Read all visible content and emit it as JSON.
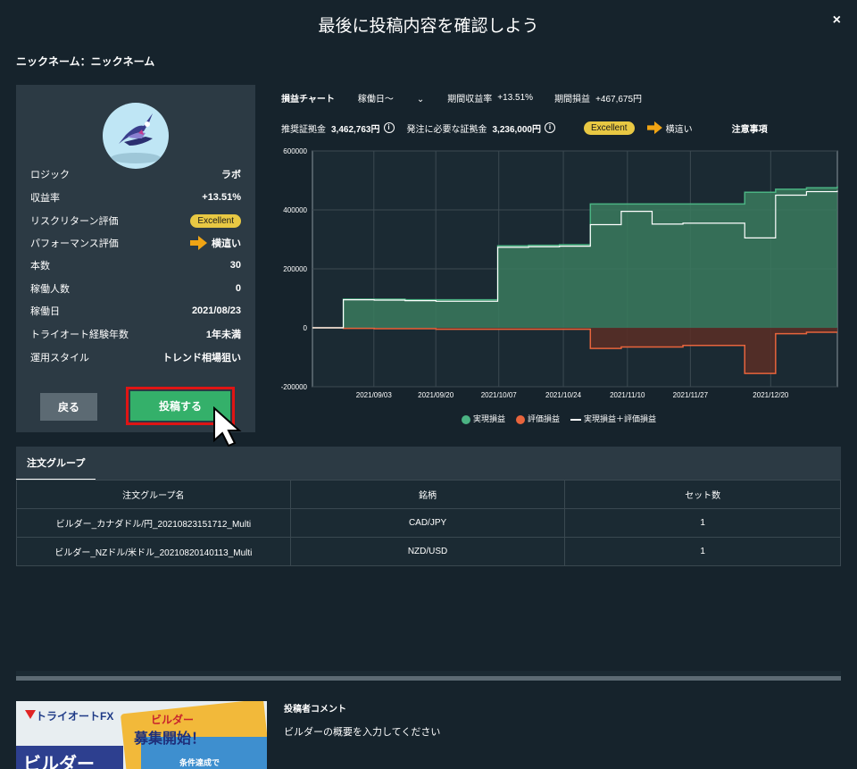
{
  "modal": {
    "title": "最後に投稿内容を確認しよう",
    "close": "×",
    "nickname_line": "ニックネーム：ニックネーム"
  },
  "profile": {
    "stats": [
      {
        "label": "ロジック",
        "value": "ラボ"
      },
      {
        "label": "収益率",
        "value": "+13.51%"
      },
      {
        "label": "リスクリターン評価",
        "value": "Excellent"
      },
      {
        "label": "パフォーマンス評価",
        "value": "横這い"
      },
      {
        "label": "本数",
        "value": "30"
      },
      {
        "label": "稼働人数",
        "value": "0"
      },
      {
        "label": "稼働日",
        "value": "2021/08/23"
      },
      {
        "label": "トライオート経験年数",
        "value": "1年未満"
      },
      {
        "label": "運用スタイル",
        "value": "トレンド相場狙い"
      }
    ],
    "back_label": "戻る",
    "post_label": "投稿する"
  },
  "chart_header": {
    "title": "損益チャート",
    "dropdown": "稼働日〜",
    "period_rate_label": "期間収益率",
    "period_rate_value": "+13.51%",
    "period_pl_label": "期間損益",
    "period_pl_value": "+467,675円",
    "recommended_label": "推奨証拠金",
    "recommended_value": "3,462,763円",
    "required_label": "発注に必要な証拠金",
    "required_value": "3,236,000円",
    "badge": "Excellent",
    "trend": "横這い",
    "notes": "注意事項"
  },
  "chart_data": {
    "type": "area",
    "x": [
      "2021/09/03",
      "2021/09/20",
      "2021/10/07",
      "2021/10/24",
      "2021/11/10",
      "2021/11/27",
      "2021/12/20"
    ],
    "ylim": [
      -200000,
      600000
    ],
    "yticks": [
      600000,
      400000,
      200000,
      0,
      -200000
    ],
    "colors": {
      "realized": "#3a7a5e",
      "unrealized": "#5a2e26",
      "realized_line": "#4bb383",
      "unrealized_line": "#e8643c",
      "total_line": "#ffffff"
    },
    "series": [
      {
        "name": "実現損益",
        "values": [
          0,
          97000,
          97000,
          95000,
          95000,
          95000,
          278000,
          280000,
          282000,
          420000,
          420000,
          420000,
          420000,
          420000,
          460000,
          470000,
          475000,
          480000
        ]
      },
      {
        "name": "評価損益",
        "values": [
          0,
          -2000,
          -3000,
          -3000,
          -5000,
          -5000,
          -5000,
          -5000,
          -5000,
          -70000,
          -65000,
          -65000,
          -60000,
          -60000,
          -155000,
          -20000,
          -15000,
          -15000
        ]
      },
      {
        "name": "実現損益＋評価損益",
        "values": [
          0,
          95000,
          94000,
          92000,
          90000,
          90000,
          273000,
          275000,
          277000,
          350000,
          395000,
          352000,
          355000,
          355000,
          305000,
          450000,
          462000,
          465000
        ]
      }
    ]
  },
  "table": {
    "tab": "注文グループ",
    "headers": [
      "注文グループ名",
      "銘柄",
      "セット数"
    ],
    "rows": [
      [
        "ビルダー_カナダドル/円_20210823151712_Multi",
        "CAD/JPY",
        "1"
      ],
      [
        "ビルダー_NZドル/米ドル_20210820140113_Multi",
        "NZD/USD",
        "1"
      ]
    ]
  },
  "banner": {
    "logo": "トライオートFX",
    "line1": "ビルダー",
    "line2": "募集開始！",
    "line3": "条件達成で",
    "side": "ビルダー"
  },
  "comment": {
    "label": "投稿者コメント",
    "text": "ビルダーの概要を入力してください"
  }
}
